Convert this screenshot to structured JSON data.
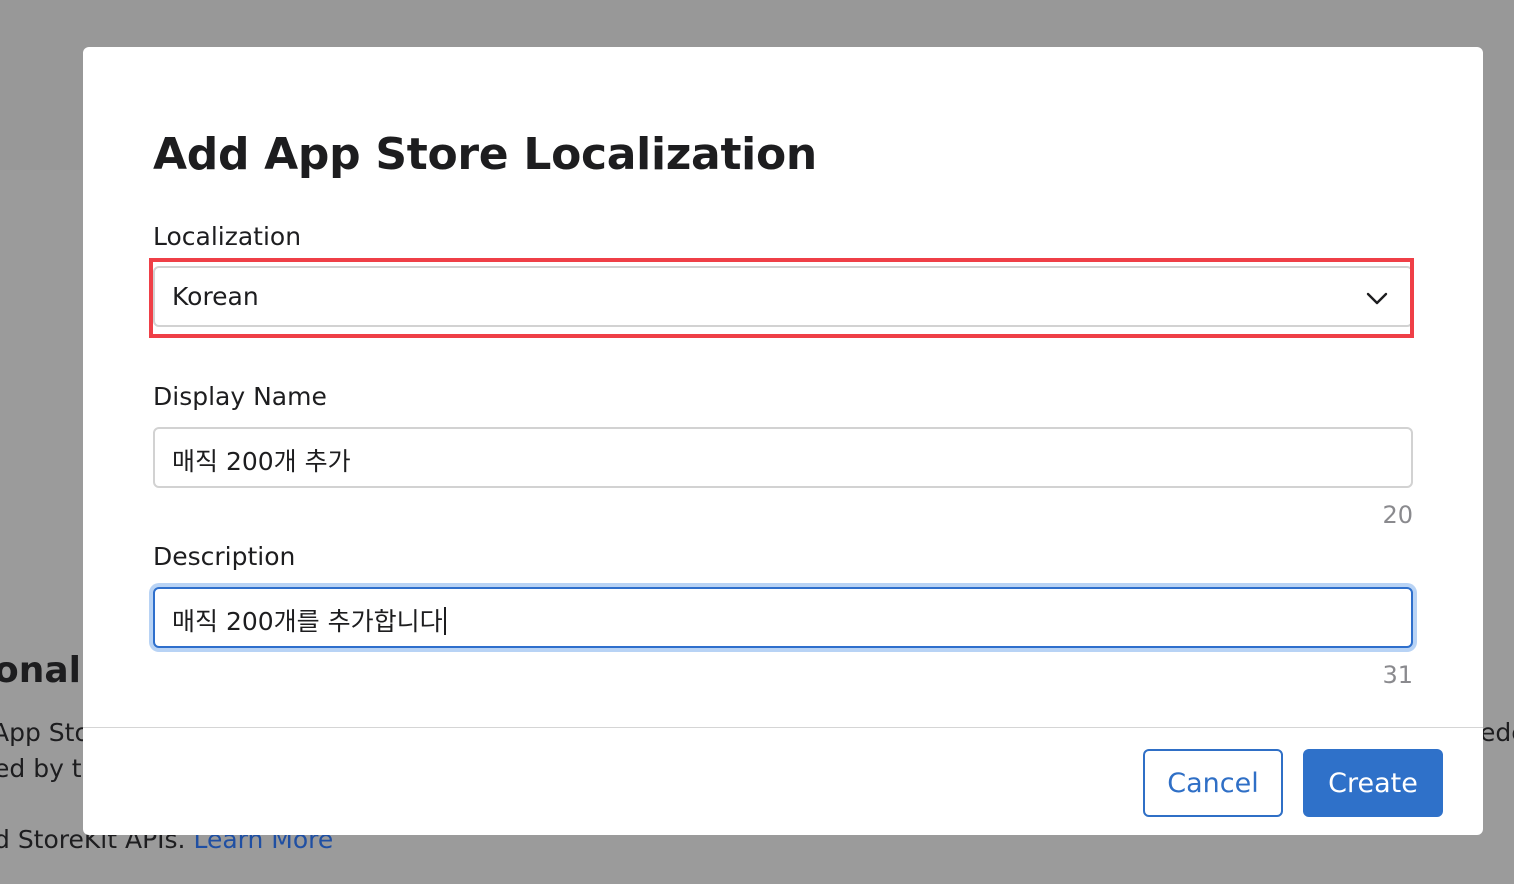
{
  "background": {
    "heading": "onal)",
    "line1": "App Sto",
    "line2": "ed by tl",
    "right_fragment": "ede",
    "line3_text": "d StoreKit APIs. ",
    "line3_link": "Learn More"
  },
  "dialog": {
    "title": "Add App Store Localization",
    "localization": {
      "label": "Localization",
      "selected": "Korean",
      "icon": "chevron-down-icon"
    },
    "display_name": {
      "label": "Display Name",
      "value": "매직 200개 추가",
      "counter": "20"
    },
    "description": {
      "label": "Description",
      "value": "매직 200개를 추가합니다",
      "counter": "31"
    },
    "buttons": {
      "cancel": "Cancel",
      "create": "Create"
    }
  },
  "colors": {
    "accent": "#2f71c9",
    "highlight": "#ef3f47",
    "overlay": "#9b9b9b"
  }
}
